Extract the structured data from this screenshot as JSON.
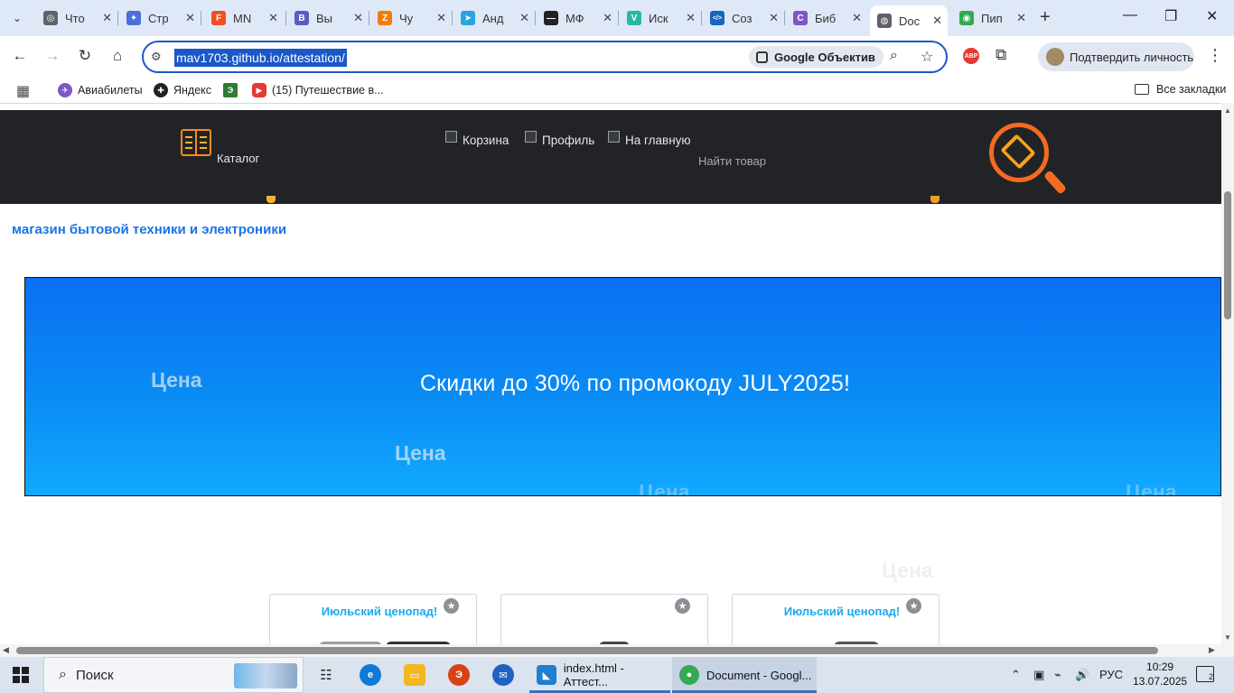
{
  "browser": {
    "tabs": [
      {
        "title": "Что",
        "fav_color": "#5f6368",
        "fav_glyph": "◎",
        "icon": "chrome-icon"
      },
      {
        "title": "Стр",
        "fav_color": "#4a6fd6",
        "fav_glyph": "✦",
        "icon": "page-icon"
      },
      {
        "title": "MN",
        "fav_color": "#f24e1e",
        "fav_glyph": "F",
        "icon": "figma-icon"
      },
      {
        "title": "Вы",
        "fav_color": "#5b5cc2",
        "fav_glyph": "B",
        "icon": "bitrix-icon"
      },
      {
        "title": "Чу",
        "fav_color": "#f57c00",
        "fav_glyph": "Z",
        "icon": "zen-icon"
      },
      {
        "title": "Анд",
        "fav_color": "#2aa3df",
        "fav_glyph": "➤",
        "icon": "telegram-icon"
      },
      {
        "title": "МФ",
        "fav_color": "#222222",
        "fav_glyph": "—",
        "icon": "mf-icon"
      },
      {
        "title": "Иск",
        "fav_color": "#27b7a4",
        "fav_glyph": "V",
        "icon": "vue-icon"
      },
      {
        "title": "Соз",
        "fav_color": "#1565c0",
        "fav_glyph": "</>",
        "icon": "code-icon"
      },
      {
        "title": "Биб",
        "fav_color": "#7e57c2",
        "fav_glyph": "C",
        "icon": "library-icon"
      },
      {
        "title": "Doc",
        "fav_color": "#5f6368",
        "fav_glyph": "◍",
        "icon": "globe-icon",
        "active": true
      },
      {
        "title": "Пип",
        "fav_color": "#34a853",
        "fav_glyph": "◉",
        "icon": "chrome-color-icon"
      }
    ],
    "new_tab": "+",
    "address": "mav1703.github.io/attestation/",
    "lens_label": "Google Объектив",
    "profile_label": "Подтвердить личность",
    "abp_label": "ABP",
    "bookmarks": [
      {
        "label": "Авиабилеты",
        "color": "#7e57c2",
        "icon": "aviatickets-icon"
      },
      {
        "label": "Яндекс",
        "color": "#222222",
        "icon": "yandex-icon"
      },
      {
        "label": "",
        "color": "#2e7d32",
        "icon": "green-bookmark-icon"
      },
      {
        "label": "(15) Путешествие в...",
        "color": "#e53935",
        "icon": "youtube-icon"
      }
    ],
    "all_bookmarks": "Все закладки"
  },
  "site": {
    "catalog": "Каталог",
    "nav": [
      "Корзина",
      "Профиль",
      "На главную"
    ],
    "search_placeholder": "Найти товар",
    "tagline": "магазин бытовой техники и электроники",
    "promo_text": "Скидки до 30% по промокоду JULY2025!",
    "floating_label": "Цена",
    "card_tag": "Июльский ценопад!",
    "colors": {
      "header": "#222326",
      "accent_orange": "#f36b21",
      "banner_top": "#0a6ff3",
      "banner_bottom": "#12a9ff",
      "tag_blue": "#19aaf1",
      "tagline_blue": "#1a73e8"
    }
  },
  "taskbar": {
    "search_placeholder": "Поиск",
    "apps": [
      {
        "label": "index.html - Аттест...",
        "icon": "vscode-icon",
        "color": "#1f7fd0"
      },
      {
        "label": "Document - Googl...",
        "icon": "chrome-icon",
        "color": "#34a853"
      }
    ],
    "language": "РУС",
    "time": "10:29",
    "date": "13.07.2025",
    "notifications": "2"
  }
}
